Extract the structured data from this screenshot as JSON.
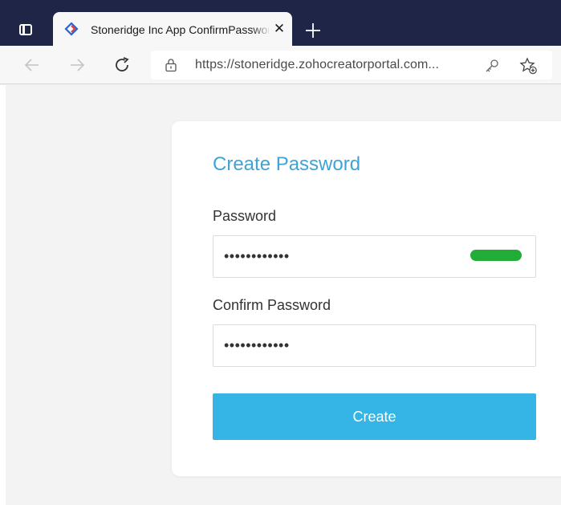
{
  "browser": {
    "tab": {
      "title": "Stoneridge Inc App ConfirmPassword",
      "favicon": "zoho-creator-icon"
    },
    "address": {
      "url": "https://stoneridge.zohocreatorportal.com..."
    },
    "icons": {
      "tab_actions": "tab-actions-icon",
      "close": "close-icon",
      "new_tab": "plus-icon",
      "back": "arrow-left-icon",
      "forward": "arrow-right-icon",
      "reload": "reload-icon",
      "lock": "lock-icon",
      "password_manager": "key-icon",
      "favorites": "star-add-icon"
    },
    "colors": {
      "tabstrip": "#1e2546",
      "toolbar": "#f7f7f7"
    }
  },
  "form": {
    "title": "Create Password",
    "password": {
      "label": "Password",
      "value": "••••••••••••",
      "strength_color": "#22ac38"
    },
    "confirm_password": {
      "label": "Confirm Password",
      "value": "••••••••••••"
    },
    "submit": {
      "label": "Create",
      "color": "#35b5e5"
    },
    "colors": {
      "title": "#3fa3d5"
    }
  }
}
